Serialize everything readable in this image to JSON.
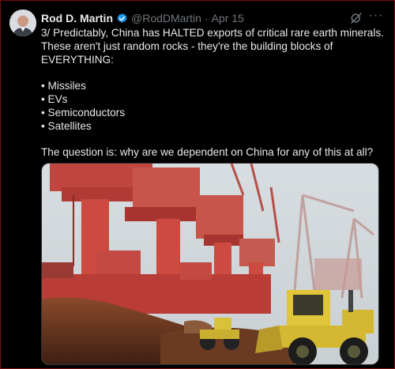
{
  "tweet": {
    "author_name": "Rod D. Martin",
    "handle": "@RodDMartin",
    "separator": "·",
    "date": "Apr 15",
    "more_label": "···",
    "lines": [
      "3/ Predictably, China has HALTED exports of critical rare earth minerals.",
      "These aren't just random rocks - they're the building blocks of",
      "EVERYTHING:",
      "",
      "• Missiles",
      "• EVs",
      "• Semiconductors",
      "• Satellites",
      "",
      "The question is: why are we dependent on China for any of this at all?"
    ]
  },
  "icons": {
    "verified": "verified-badge-icon",
    "grok": "grok-icon",
    "more": "more-options-icon"
  },
  "colors": {
    "background": "#000000",
    "text": "#e7e9ea",
    "secondary": "#71767b",
    "verified": "#1d9bf0",
    "border": "#7a0d0d"
  }
}
